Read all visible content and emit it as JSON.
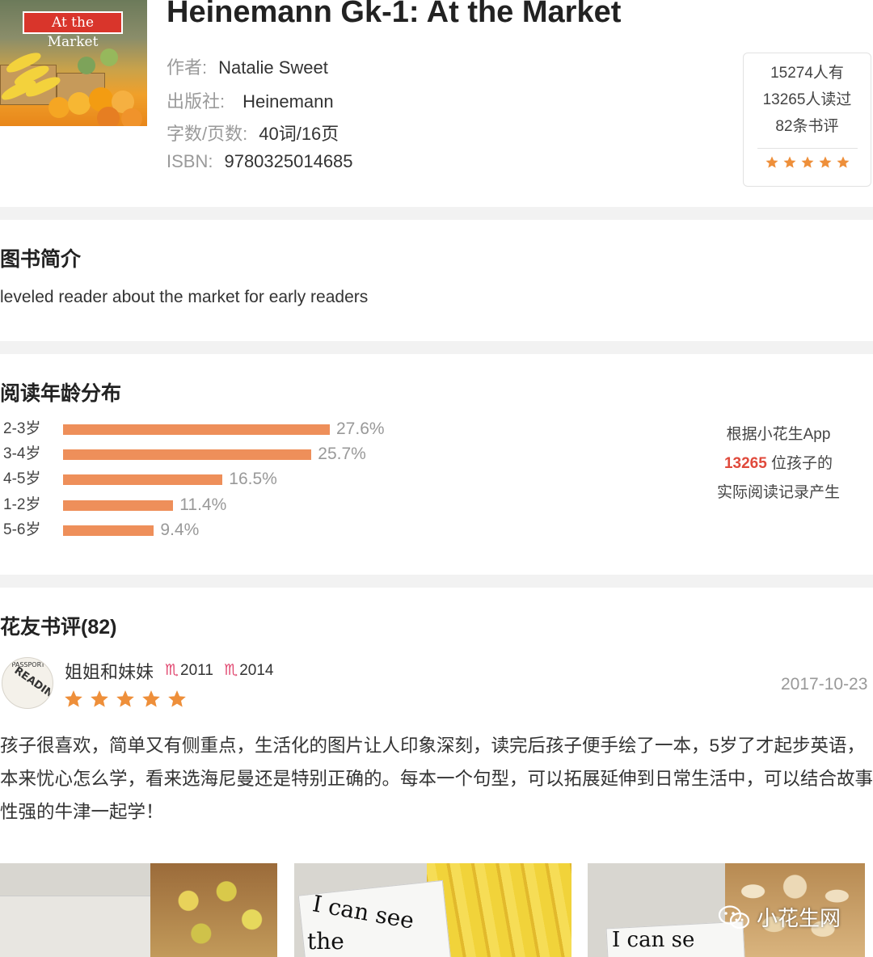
{
  "book": {
    "cover_banner": "At the Market",
    "title": "Heinemann Gk-1: At the Market",
    "author_label": "作者:",
    "author": "Natalie Sweet",
    "publisher_label": "出版社:",
    "publisher": "Heinemann",
    "length_label": "字数/页数:",
    "length": "40词/16页",
    "isbn_label": "ISBN:",
    "isbn": "9780325014685"
  },
  "stats": {
    "have": "15274人有",
    "read": "13265人读过",
    "reviews": "82条书评",
    "rating": 5
  },
  "intro": {
    "title": "图书简介",
    "text": "leveled reader about the market for early readers"
  },
  "age": {
    "title": "阅读年龄分布",
    "rows": [
      {
        "label": "2-3岁",
        "pct_text": "27.6%",
        "value": 27.6
      },
      {
        "label": "3-4岁",
        "pct_text": "25.7%",
        "value": 25.7
      },
      {
        "label": "4-5岁",
        "pct_text": "16.5%",
        "value": 16.5
      },
      {
        "label": "1-2岁",
        "pct_text": "11.4%",
        "value": 11.4
      },
      {
        "label": "5-6岁",
        "pct_text": "9.4%",
        "value": 9.4
      }
    ],
    "note_line1": "根据小花生App",
    "note_count": "13265",
    "note_line2_suffix": " 位孩子的",
    "note_line3": "实际阅读记录产生",
    "bar_color": "#ee8f5a"
  },
  "reviews": {
    "title": "花友书评(82)",
    "items": [
      {
        "user": "姐姐和妹妹",
        "avatar_text_top": "PASSPORT",
        "avatar_text_main": "READING",
        "kid1_icon": "♏",
        "kid1_year": "2011",
        "kid2_icon": "♏",
        "kid2_year": "2014",
        "rating": 5,
        "date": "2017-10-23",
        "text": "孩子很喜欢，简单又有侧重点，生活化的图片让人印象深刻，读完后孩子便手绘了一本，5岁了才起步英语，本来忧心怎么学，看来选海尼曼还是特别正确的。每本一个句型，可以拓展延伸到日常生活中，可以结合故事性强的牛津一起学！"
      }
    ]
  },
  "photos": [
    {
      "hand_text": ""
    },
    {
      "hand_text_1": "I can see",
      "hand_text_2": "the"
    },
    {
      "hand_text_1": "I can se"
    }
  ],
  "watermark": {
    "text": "小花生网",
    "icon": "wechat-icon"
  },
  "colors": {
    "star": "#ee8f3a",
    "accent_red": "#e04a3c",
    "bar": "#ee8f5a"
  }
}
